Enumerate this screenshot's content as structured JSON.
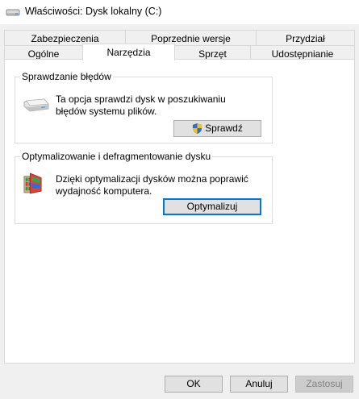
{
  "window": {
    "title": "Właściwości: Dysk lokalny (C:)",
    "icon": "drive-icon"
  },
  "tabs": {
    "row1": [
      "Zabezpieczenia",
      "Poprzednie wersje",
      "Przydział"
    ],
    "row2": [
      "Ogólne",
      "Narzędzia",
      "Sprzęt",
      "Udostępnianie"
    ],
    "active": "Narzędzia"
  },
  "error_check": {
    "title": "Sprawdzanie błędów",
    "description_line1": "Ta opcja sprawdzi dysk w poszukiwaniu",
    "description_line2": "błędów systemu plików.",
    "button_label": "Sprawdź",
    "icon": "hard-drive-icon",
    "button_icon": "uac-shield-icon"
  },
  "optimize": {
    "title": "Optymalizowanie i defragmentowanie dysku",
    "description_line1": "Dzięki optymalizacji dysków można poprawić",
    "description_line2": "wydajność komputera.",
    "button_label": "Optymalizuj",
    "icon": "defrag-icon"
  },
  "footer": {
    "ok_label": "OK",
    "cancel_label": "Anuluj",
    "apply_label": "Zastosuj"
  },
  "colors": {
    "accent": "#0078d7",
    "panel": "#ffffff",
    "dialog": "#f0f0f0"
  }
}
